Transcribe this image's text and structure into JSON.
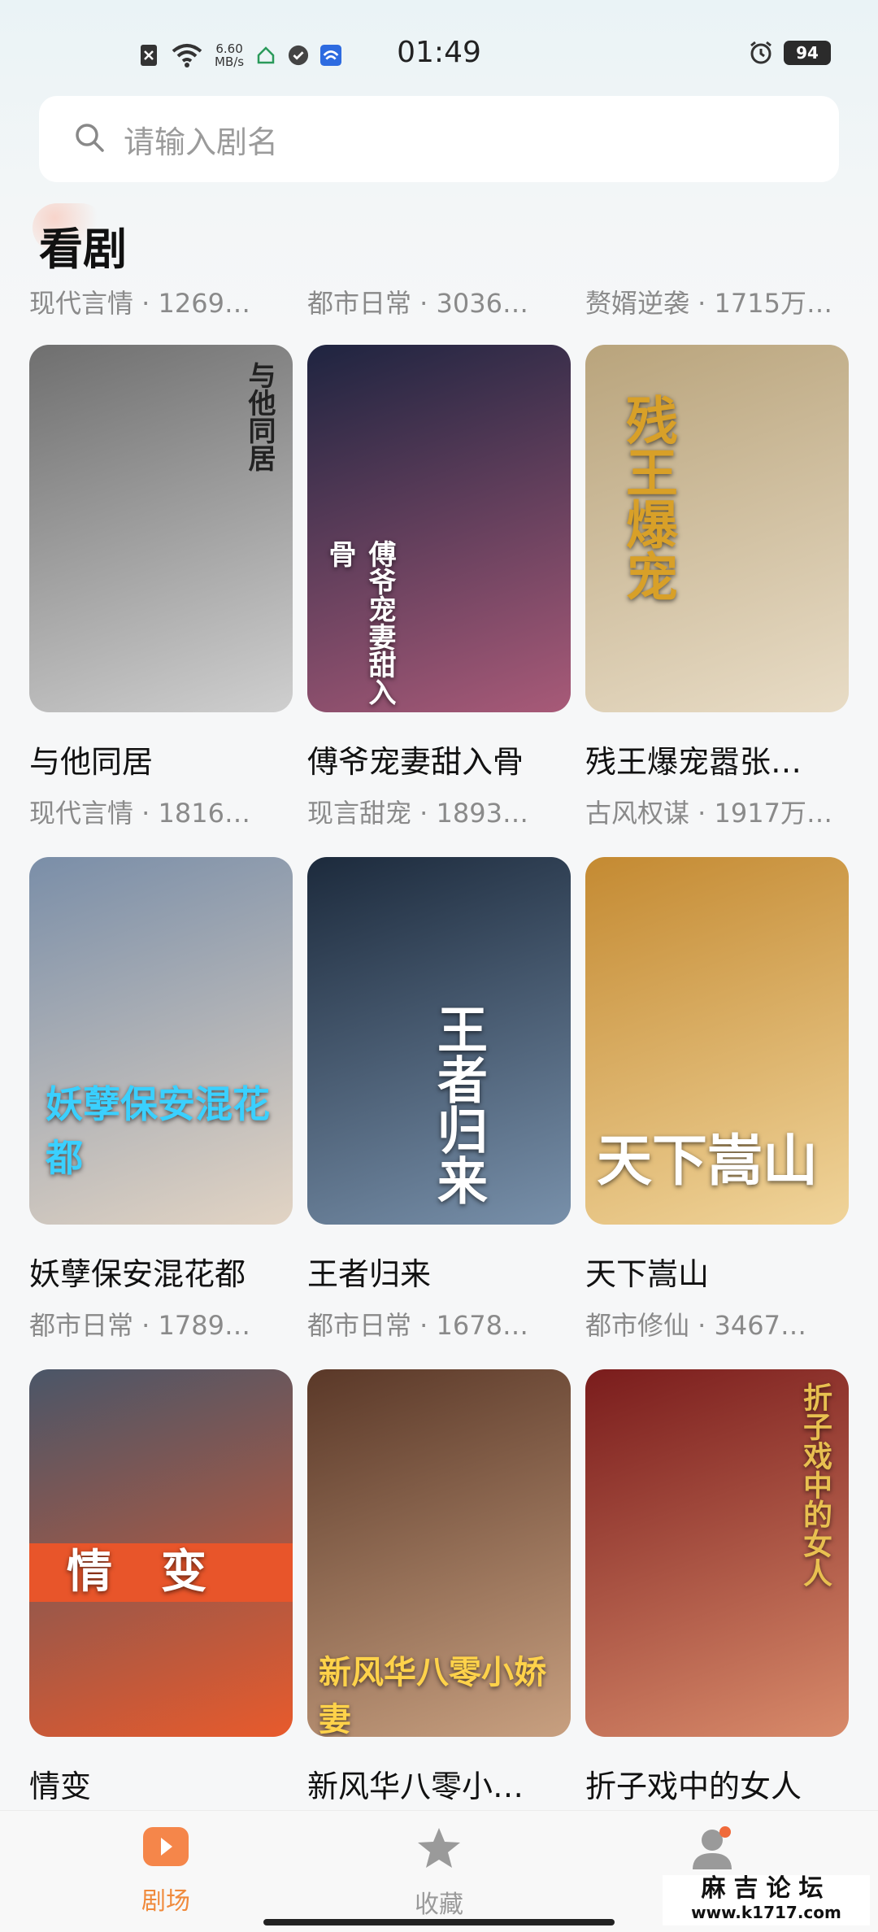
{
  "status_bar": {
    "time": "01:49",
    "net_speed_value": "6.60",
    "net_speed_unit": "MB/s",
    "battery": "94"
  },
  "search": {
    "placeholder": "请输入剧名"
  },
  "section": {
    "title": "看剧",
    "top_row_subtitles": [
      "现代言情 · 1269…",
      "都市日常 · 3036…",
      "赘婿逆袭 · 1715万…"
    ]
  },
  "dramas": [
    {
      "title": "与他同居",
      "subtitle": "现代言情 · 1816…",
      "poster_text": "与他同居",
      "colors": [
        "#6f6f6f",
        "#cfcfcf"
      ]
    },
    {
      "title": "傅爷宠妻甜入骨",
      "subtitle": "现言甜宠 · 1893…",
      "poster_text": "傅爷宠妻甜入骨",
      "colors": [
        "#1e2440",
        "#a85a78"
      ]
    },
    {
      "title": "残王爆宠嚣张…",
      "subtitle": "古风权谋 · 1917万…",
      "poster_text": "残王爆宠",
      "colors": [
        "#b9a47c",
        "#e8dcc6"
      ]
    },
    {
      "title": "妖孽保安混花都",
      "subtitle": "都市日常 · 1789…",
      "poster_text": "妖孽保安混花都",
      "colors": [
        "#7a8ea8",
        "#e2d4c4"
      ]
    },
    {
      "title": "王者归来",
      "subtitle": "都市日常 · 1678…",
      "poster_text": "王者归来",
      "colors": [
        "#1c2a3c",
        "#7890aa"
      ]
    },
    {
      "title": "天下嵩山",
      "subtitle": "都市修仙 · 3467…",
      "poster_text": "天下嵩山",
      "colors": [
        "#c48a32",
        "#f0d49a"
      ]
    },
    {
      "title": "情变",
      "subtitle": "",
      "poster_text": "情变",
      "colors": [
        "#4a5668",
        "#e85a2c"
      ]
    },
    {
      "title": "新风华八零小…",
      "subtitle": "",
      "poster_text": "新风华八零小娇妻",
      "colors": [
        "#5a3828",
        "#c8a080"
      ]
    },
    {
      "title": "折子戏中的女人",
      "subtitle": "",
      "poster_text": "折子戏中的女人",
      "colors": [
        "#7a1c1c",
        "#d88a6a"
      ]
    }
  ],
  "bottom_nav": {
    "items": [
      {
        "label": "剧场",
        "active": true
      },
      {
        "label": "收藏",
        "active": false
      },
      {
        "label": "",
        "active": false
      }
    ]
  },
  "watermark": {
    "line1": "麻吉论坛",
    "line2": "www.k1717.com"
  },
  "colors": {
    "accent": "#f08a3c",
    "background": "#f6f7f8"
  }
}
